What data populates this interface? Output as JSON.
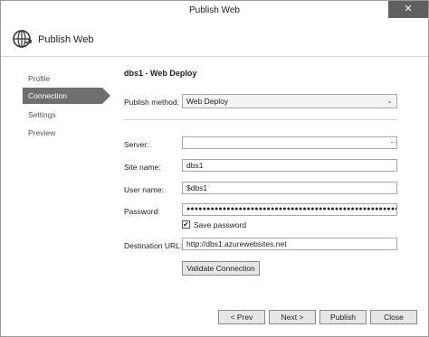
{
  "window": {
    "title": "Publish Web",
    "close_glyph": "✕"
  },
  "header": {
    "title": "Publish Web",
    "icon": "globe-icon"
  },
  "sidebar": {
    "items": [
      {
        "label": "Profile",
        "active": false
      },
      {
        "label": "Connection",
        "active": true
      },
      {
        "label": "Settings",
        "active": false
      },
      {
        "label": "Preview",
        "active": false
      }
    ]
  },
  "main": {
    "section_title": "dbs1 - Web Deploy",
    "publish_method": {
      "label": "Publish method:",
      "value": "Web Deploy"
    },
    "server": {
      "label": "Server:",
      "value": ""
    },
    "site_name": {
      "label": "Site name:",
      "value": "dbs1"
    },
    "user_name": {
      "label": "User name:",
      "value": "$dbs1"
    },
    "password": {
      "label": "Password:",
      "value": "●●●●●●●●●●●●●●●●●●●●●●●●●●●●●●●●●●●●●●●●●●●●●●●●●●●●●●●●●●●●"
    },
    "save_password": {
      "label": "Save password",
      "checked": true,
      "check_glyph": "✔"
    },
    "destination_url": {
      "label": "Destination URL:",
      "value": "http://dbs1.azurewebsites.net"
    },
    "validate_button": "Validate Connection"
  },
  "footer": {
    "prev": "< Prev",
    "next": "Next >",
    "publish": "Publish",
    "close": "Close"
  }
}
